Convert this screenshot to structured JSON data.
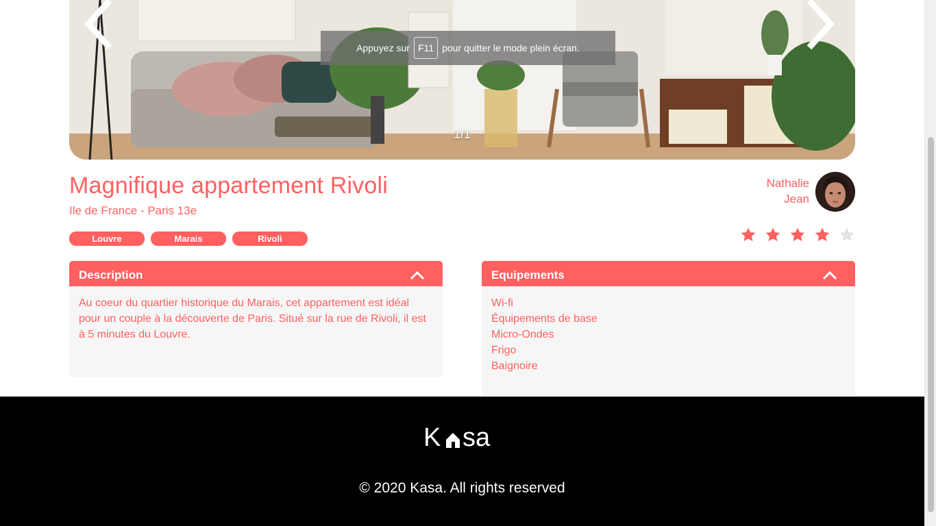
{
  "gallery": {
    "counter": "1/1",
    "prev_icon": "chevron-left-icon",
    "next_icon": "chevron-right-icon"
  },
  "fullscreen_notice": {
    "before": "Appuyez sur",
    "key": "F11",
    "after": "pour quitter le mode plein écran."
  },
  "listing": {
    "title": "Magnifique appartement Rivoli",
    "location": "Ile de France - Paris 13e",
    "tags": [
      "Louvre",
      "Marais",
      "Rivoli"
    ]
  },
  "host": {
    "first_name": "Nathalie",
    "last_name": "Jean"
  },
  "rating": {
    "value": 4,
    "max": 5
  },
  "description": {
    "label": "Description",
    "text": "Au coeur du quartier historique du Marais, cet appartement est idéal pour un couple à la découverte de Paris. Situé sur la rue de Rivoli, il est à 5 minutes du Louvre."
  },
  "equipments": {
    "label": "Equipements",
    "items": [
      "Wi-fi",
      "Équipements de base",
      "Micro-Ondes",
      "Frigo",
      "Baignoire"
    ]
  },
  "footer": {
    "brand": "Kasa",
    "copyright": "© 2020 Kasa. All rights reserved"
  },
  "colors": {
    "accent": "#ff6060",
    "panel": "#f6f6f6",
    "footer_bg": "#000000",
    "star_empty": "#e3e3e3"
  }
}
